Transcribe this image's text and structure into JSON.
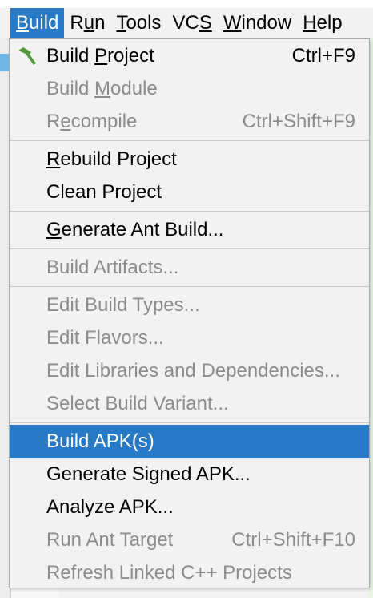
{
  "menubar": {
    "items": [
      {
        "label": "Build",
        "mnemonic_index": 0,
        "active": true
      },
      {
        "label": "Run",
        "mnemonic_index": 1
      },
      {
        "label": "Tools",
        "mnemonic_index": 0
      },
      {
        "label": "VCS",
        "mnemonic_index": 2
      },
      {
        "label": "Window",
        "mnemonic_index": 0
      },
      {
        "label": "Help",
        "mnemonic_index": 0
      }
    ]
  },
  "build_menu": {
    "items": [
      {
        "type": "item",
        "label": "Build Project",
        "mnemonic_index": 6,
        "shortcut": "Ctrl+F9",
        "enabled": true,
        "icon": "hammer-icon"
      },
      {
        "type": "item",
        "label": "Build Module",
        "mnemonic_index": 6,
        "shortcut": "",
        "enabled": false
      },
      {
        "type": "item",
        "label": "Recompile",
        "mnemonic_index": 1,
        "shortcut": "Ctrl+Shift+F9",
        "enabled": false
      },
      {
        "type": "separator"
      },
      {
        "type": "item",
        "label": "Rebuild Project",
        "mnemonic_index": 0,
        "shortcut": "",
        "enabled": true
      },
      {
        "type": "item",
        "label": "Clean Project",
        "mnemonic_index": -1,
        "shortcut": "",
        "enabled": true
      },
      {
        "type": "separator"
      },
      {
        "type": "item",
        "label": "Generate Ant Build...",
        "mnemonic_index": 0,
        "shortcut": "",
        "enabled": true
      },
      {
        "type": "separator"
      },
      {
        "type": "item",
        "label": "Build Artifacts...",
        "mnemonic_index": -1,
        "shortcut": "",
        "enabled": false
      },
      {
        "type": "separator"
      },
      {
        "type": "item",
        "label": "Edit Build Types...",
        "mnemonic_index": -1,
        "shortcut": "",
        "enabled": false
      },
      {
        "type": "item",
        "label": "Edit Flavors...",
        "mnemonic_index": -1,
        "shortcut": "",
        "enabled": false
      },
      {
        "type": "item",
        "label": "Edit Libraries and Dependencies...",
        "mnemonic_index": -1,
        "shortcut": "",
        "enabled": false
      },
      {
        "type": "item",
        "label": "Select Build Variant...",
        "mnemonic_index": -1,
        "shortcut": "",
        "enabled": false
      },
      {
        "type": "separator"
      },
      {
        "type": "item",
        "label": "Build APK(s)",
        "mnemonic_index": -1,
        "shortcut": "",
        "enabled": true,
        "highlighted": true
      },
      {
        "type": "item",
        "label": "Generate Signed APK...",
        "mnemonic_index": -1,
        "shortcut": "",
        "enabled": true
      },
      {
        "type": "item",
        "label": "Analyze APK...",
        "mnemonic_index": -1,
        "shortcut": "",
        "enabled": true
      },
      {
        "type": "item",
        "label": "Run Ant Target",
        "mnemonic_index": -1,
        "shortcut": "Ctrl+Shift+F10",
        "enabled": false
      },
      {
        "type": "item",
        "label": "Refresh Linked C++ Projects",
        "mnemonic_index": -1,
        "shortcut": "",
        "enabled": false
      }
    ]
  },
  "colors": {
    "highlight": "#2879c6",
    "disabled_text": "#8c8c8c",
    "menu_background": "#f2f2f2",
    "hammer_icon": "#4f9a3a"
  }
}
